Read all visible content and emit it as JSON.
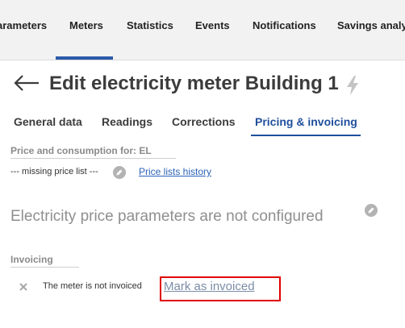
{
  "topnav": {
    "items": [
      {
        "label": "arameters"
      },
      {
        "label": "Meters",
        "active": true
      },
      {
        "label": "Statistics"
      },
      {
        "label": "Events"
      },
      {
        "label": "Notifications"
      },
      {
        "label": "Savings analys"
      }
    ]
  },
  "header": {
    "title": "Edit electricity meter Building 1",
    "back_icon": "arrow-left-icon",
    "meter_type_icon": "lightning-bolt-icon"
  },
  "tabs": [
    {
      "label": "General data"
    },
    {
      "label": "Readings"
    },
    {
      "label": "Corrections"
    },
    {
      "label": "Pricing & invoicing",
      "active": true
    }
  ],
  "pricing": {
    "section_label": "Price and consumption for: EL",
    "price_list_value": "--- missing price list ---",
    "history_link": "Price lists history",
    "not_configured_text": "Electricity price parameters are not configured"
  },
  "invoicing": {
    "section_label": "Invoicing",
    "status_text": "The meter is not invoiced",
    "action_link": "Mark as invoiced"
  },
  "colors": {
    "accent": "#1f4f9c",
    "link": "#2c63b6",
    "highlight": "#e00000",
    "nav_background": "#f2f2f2"
  }
}
